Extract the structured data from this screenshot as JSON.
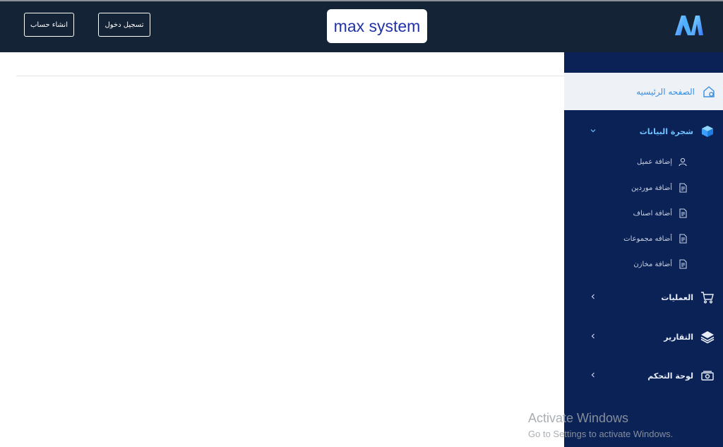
{
  "header": {
    "brand": "max system",
    "signup_label": "انشاء حساب",
    "login_label": "تسجيل دخول",
    "logo_icon": "m-logo-icon"
  },
  "sidebar": {
    "home": {
      "label": "الصفحه الرئيسيه",
      "icon": "home-icon"
    },
    "data_tree": {
      "label": "شجرة البيانات",
      "icon": "cube-icon",
      "expanded": true,
      "items": [
        {
          "label": "إضافة عميل",
          "icon": "user-icon"
        },
        {
          "label": "أضافة موردين",
          "icon": "document-icon"
        },
        {
          "label": "أضافة اصناف",
          "icon": "document-icon"
        },
        {
          "label": "أضافه مجموعات",
          "icon": "document-icon"
        },
        {
          "label": "أضافة مخازن",
          "icon": "document-icon"
        }
      ]
    },
    "operations": {
      "label": "العمليات",
      "icon": "cart-icon"
    },
    "reports": {
      "label": "التقارير",
      "icon": "layers-icon"
    },
    "dashboard": {
      "label": "لوحة التحكم",
      "icon": "cash-icon"
    }
  },
  "watermark": {
    "title": "Activate Windows",
    "subtitle": "Go to Settings to activate Windows."
  },
  "colors": {
    "topbar": "#142336",
    "sidebar": "#0b2257",
    "accent": "#3a8fe0",
    "brand_text": "#2233aa"
  }
}
